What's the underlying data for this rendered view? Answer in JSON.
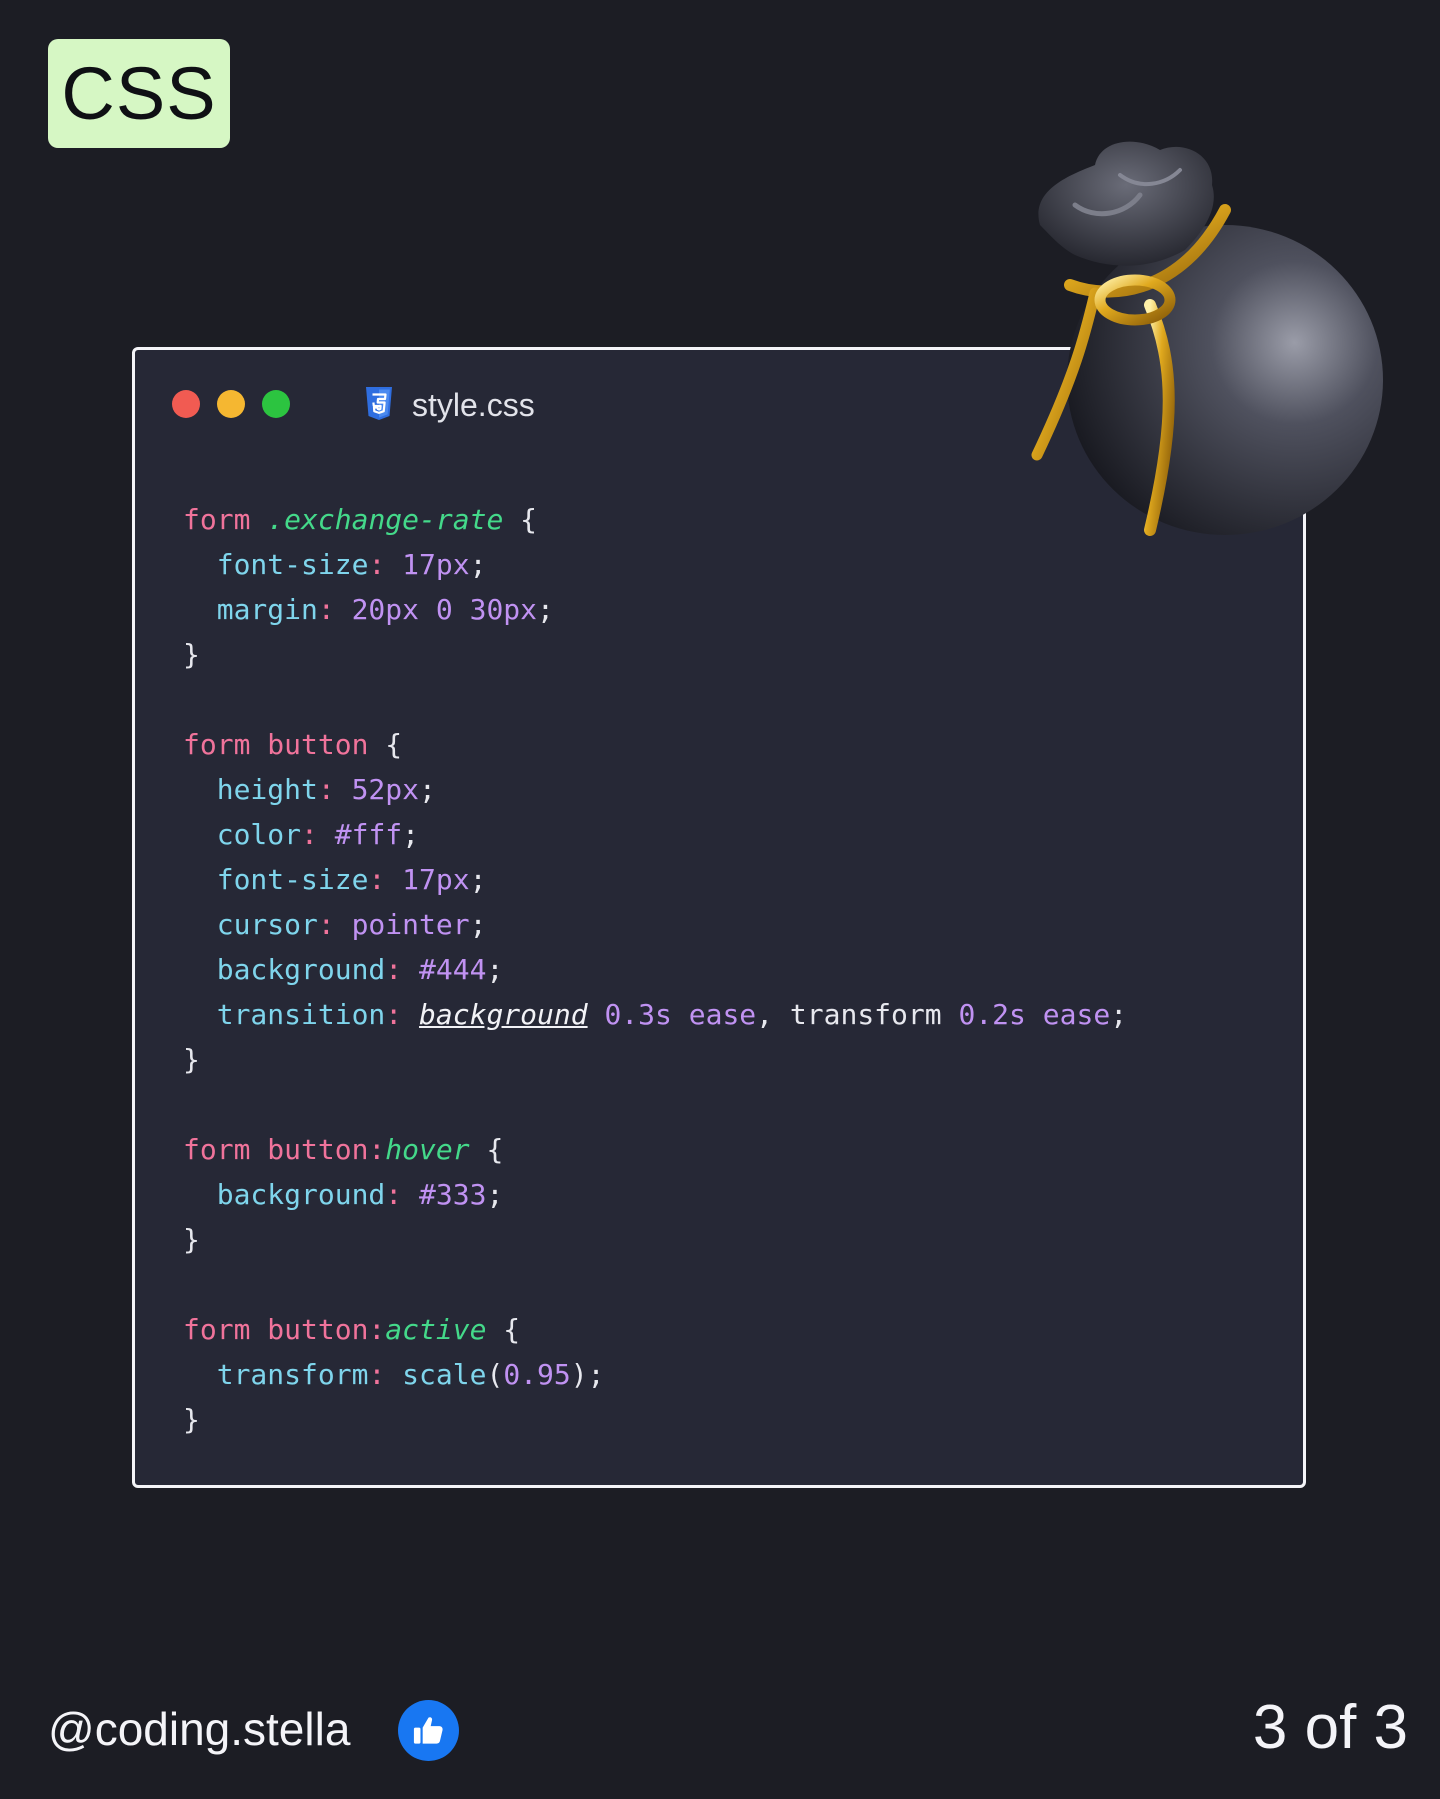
{
  "badge": {
    "label": "CSS"
  },
  "editor": {
    "filename": "style.css",
    "file_icon": "css3-icon",
    "window_controls": [
      "close",
      "minimize",
      "maximize"
    ],
    "code_lines": [
      [
        {
          "t": "form",
          "s": "k"
        },
        {
          "t": " ",
          "s": "pn"
        },
        {
          "t": ".exchange-rate",
          "s": "c"
        },
        {
          "t": " {",
          "s": "pn"
        }
      ],
      [
        {
          "t": "  font-size",
          "s": "p"
        },
        {
          "t": ": ",
          "s": "k"
        },
        {
          "t": "17px",
          "s": "n"
        },
        {
          "t": ";",
          "s": "pn"
        }
      ],
      [
        {
          "t": "  margin",
          "s": "p"
        },
        {
          "t": ": ",
          "s": "k"
        },
        {
          "t": "20px 0 30px",
          "s": "n"
        },
        {
          "t": ";",
          "s": "pn"
        }
      ],
      [
        {
          "t": "}",
          "s": "pn"
        }
      ],
      [],
      [
        {
          "t": "form button",
          "s": "k"
        },
        {
          "t": " {",
          "s": "pn"
        }
      ],
      [
        {
          "t": "  height",
          "s": "p"
        },
        {
          "t": ": ",
          "s": "k"
        },
        {
          "t": "52px",
          "s": "n"
        },
        {
          "t": ";",
          "s": "pn"
        }
      ],
      [
        {
          "t": "  color",
          "s": "p"
        },
        {
          "t": ": ",
          "s": "k"
        },
        {
          "t": "#fff",
          "s": "n"
        },
        {
          "t": ";",
          "s": "pn"
        }
      ],
      [
        {
          "t": "  font-size",
          "s": "p"
        },
        {
          "t": ": ",
          "s": "k"
        },
        {
          "t": "17px",
          "s": "n"
        },
        {
          "t": ";",
          "s": "pn"
        }
      ],
      [
        {
          "t": "  cursor",
          "s": "p"
        },
        {
          "t": ": ",
          "s": "k"
        },
        {
          "t": "pointer",
          "s": "n"
        },
        {
          "t": ";",
          "s": "pn"
        }
      ],
      [
        {
          "t": "  background",
          "s": "p"
        },
        {
          "t": ": ",
          "s": "k"
        },
        {
          "t": "#444",
          "s": "n"
        },
        {
          "t": ";",
          "s": "pn"
        }
      ],
      [
        {
          "t": "  transition",
          "s": "p"
        },
        {
          "t": ": ",
          "s": "k"
        },
        {
          "t": "background",
          "s": "u"
        },
        {
          "t": " 0.3s ease",
          "s": "n"
        },
        {
          "t": ", transform ",
          "s": "pn"
        },
        {
          "t": "0.2s ease",
          "s": "n"
        },
        {
          "t": ";",
          "s": "pn"
        }
      ],
      [
        {
          "t": "}",
          "s": "pn"
        }
      ],
      [],
      [
        {
          "t": "form button:",
          "s": "k"
        },
        {
          "t": "hover",
          "s": "c"
        },
        {
          "t": " {",
          "s": "pn"
        }
      ],
      [
        {
          "t": "  background",
          "s": "p"
        },
        {
          "t": ": ",
          "s": "k"
        },
        {
          "t": "#333",
          "s": "n"
        },
        {
          "t": ";",
          "s": "pn"
        }
      ],
      [
        {
          "t": "}",
          "s": "pn"
        }
      ],
      [],
      [
        {
          "t": "form button:",
          "s": "k"
        },
        {
          "t": "active",
          "s": "c"
        },
        {
          "t": " {",
          "s": "pn"
        }
      ],
      [
        {
          "t": "  transform",
          "s": "p"
        },
        {
          "t": ": ",
          "s": "k"
        },
        {
          "t": "scale",
          "s": "p"
        },
        {
          "t": "(",
          "s": "pn"
        },
        {
          "t": "0.95",
          "s": "n"
        },
        {
          "t": ");",
          "s": "pn"
        }
      ],
      [
        {
          "t": "}",
          "s": "pn"
        }
      ]
    ]
  },
  "footer": {
    "handle": "@coding.stella",
    "like_icon": "thumbs-up-icon",
    "pager": "3 of 3"
  },
  "decoration": {
    "image": "money-bag-icon"
  },
  "colors": {
    "background": "#1c1d24",
    "window_bg": "#262836",
    "badge_bg": "#d6f7c4",
    "keyword": "#f0739b",
    "class_selector": "#44d98a",
    "property": "#7fd5ec",
    "value": "#c092f2",
    "like_button": "#1877f2"
  }
}
